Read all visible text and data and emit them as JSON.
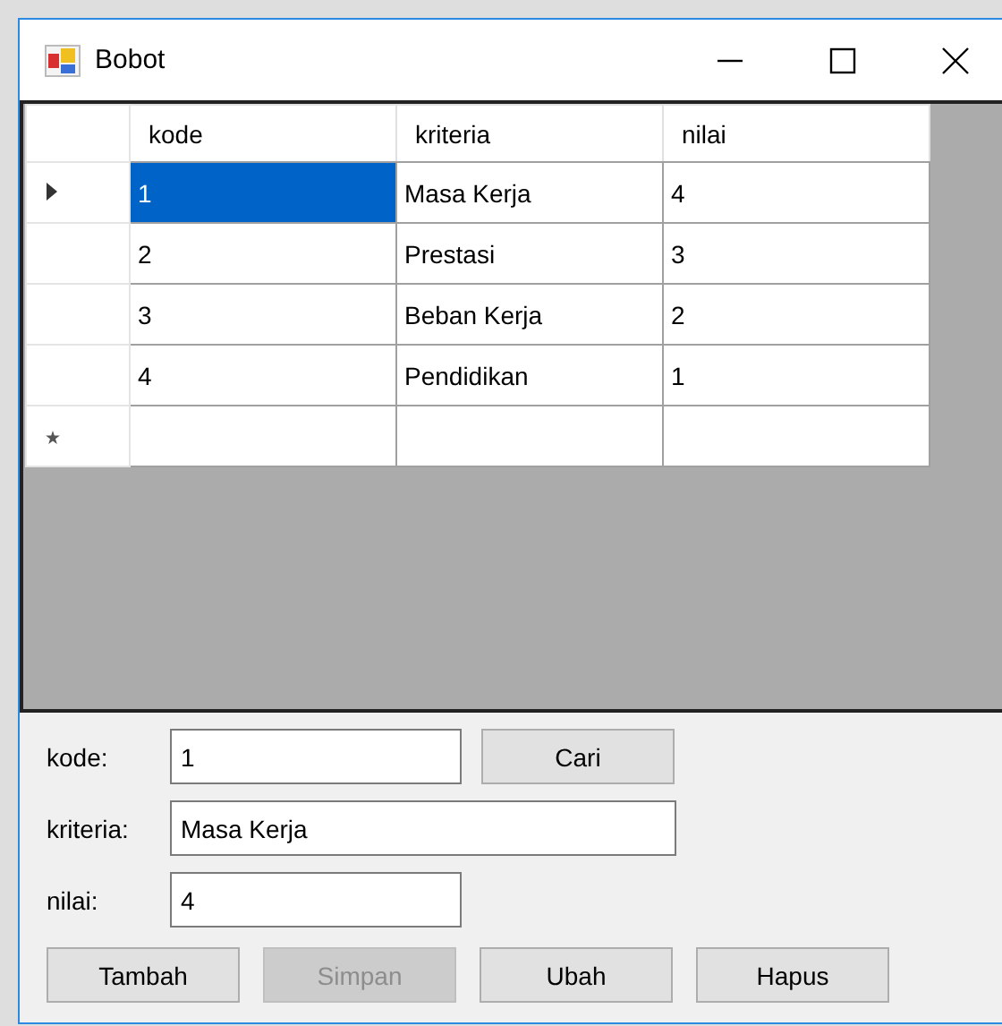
{
  "window": {
    "title": "Bobot"
  },
  "grid": {
    "columns": [
      "kode",
      "kriteria",
      "nilai"
    ],
    "rows": [
      {
        "current": true,
        "cells": [
          {
            "text": "1",
            "selected": true
          },
          {
            "text": "Masa Kerja",
            "selected": false
          },
          {
            "text": "4",
            "selected": false
          }
        ]
      },
      {
        "current": false,
        "cells": [
          {
            "text": "2",
            "selected": false
          },
          {
            "text": "Prestasi",
            "selected": false
          },
          {
            "text": "3",
            "selected": false
          }
        ]
      },
      {
        "current": false,
        "cells": [
          {
            "text": "3",
            "selected": false
          },
          {
            "text": "Beban Kerja",
            "selected": false
          },
          {
            "text": "2",
            "selected": false
          }
        ]
      },
      {
        "current": false,
        "cells": [
          {
            "text": "4",
            "selected": false
          },
          {
            "text": "Pendidikan",
            "selected": false
          },
          {
            "text": "1",
            "selected": false
          }
        ]
      }
    ],
    "new_row": true
  },
  "form": {
    "fields": [
      {
        "label": "kode:",
        "value": "1",
        "button": "Cari"
      },
      {
        "label": "kriteria:",
        "value": "Masa Kerja"
      },
      {
        "label": "nilai:",
        "value": "4"
      }
    ],
    "buttons": [
      {
        "label": "Tambah",
        "disabled": false
      },
      {
        "label": "Simpan",
        "disabled": true
      },
      {
        "label": "Ubah",
        "disabled": false
      },
      {
        "label": "Hapus",
        "disabled": false
      }
    ]
  }
}
